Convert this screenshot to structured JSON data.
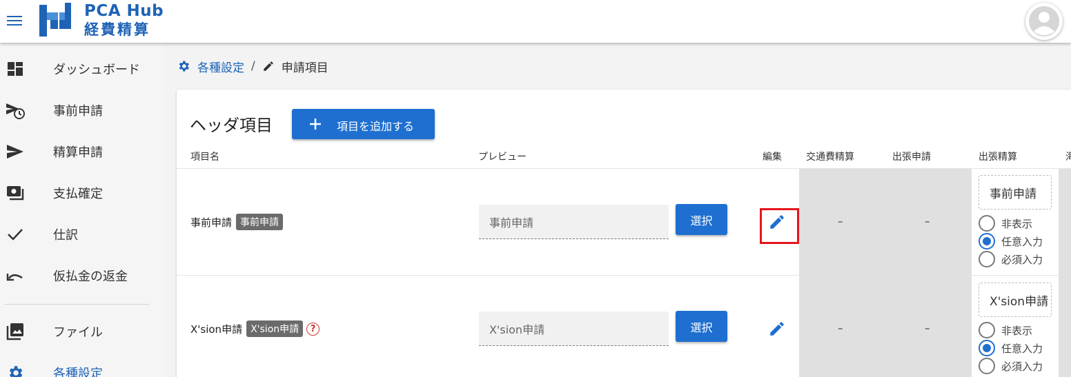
{
  "app": {
    "brand_main": "PCA Hub",
    "brand_sub": "経費精算"
  },
  "sidebar": {
    "items": [
      {
        "label": "ダッシュボード",
        "icon": "dashboard-icon"
      },
      {
        "label": "事前申請",
        "icon": "schedule-send-icon"
      },
      {
        "label": "精算申請",
        "icon": "send-icon"
      },
      {
        "label": "支払確定",
        "icon": "payments-icon"
      },
      {
        "label": "仕訳",
        "icon": "check-icon"
      },
      {
        "label": "仮払金の返金",
        "icon": "undo-icon"
      },
      {
        "label": "ファイル",
        "icon": "photo-library-icon"
      },
      {
        "label": "各種設定",
        "icon": "gear-icon"
      }
    ]
  },
  "breadcrumb": {
    "parent": "各種設定",
    "separator": "/",
    "current": "申請項目"
  },
  "card": {
    "title": "ヘッダ項目",
    "add_button": "項目を追加する",
    "columns": {
      "name": "項目名",
      "preview": "プレビュー",
      "edit": "編集",
      "transport": "交通費精算",
      "trip_request": "出張申請",
      "trip_settlement": "出張精算",
      "overflow": "海"
    },
    "rows": [
      {
        "name": "事前申請",
        "chip": "事前申請",
        "preview_placeholder": "事前申請",
        "select_label": "選択",
        "transport": "–",
        "trip_request": "–",
        "trip_settlement_value": "事前申請",
        "options": [
          "非表示",
          "任意入力",
          "必須入力"
        ],
        "selected": 1
      },
      {
        "name": "X'sion申請",
        "chip": "X'sion申請",
        "help": "?",
        "preview_placeholder": "X'sion申請",
        "select_label": "選択",
        "transport": "–",
        "trip_request": "–",
        "trip_settlement_value": "X'sion申請",
        "options": [
          "非表示",
          "任意入力",
          "必須入力"
        ],
        "selected": 1
      }
    ]
  },
  "colors": {
    "primary": "#1e6fd0",
    "brand": "#1e63b6",
    "highlight": "#e5151b"
  }
}
